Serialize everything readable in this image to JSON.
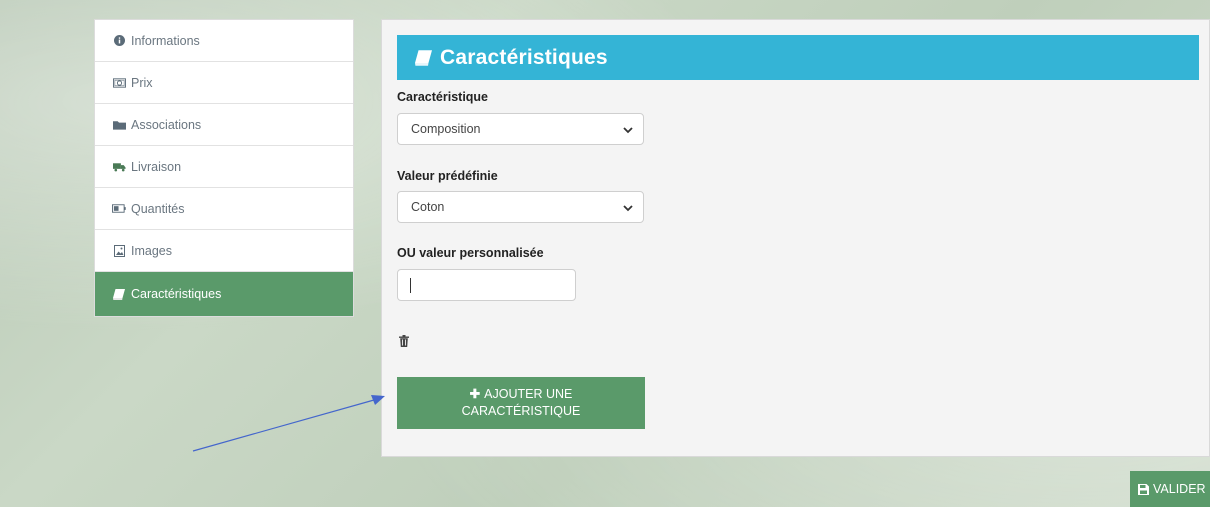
{
  "sidebar": {
    "tabs": [
      {
        "label": "Informations",
        "icon": "info-circle-icon"
      },
      {
        "label": "Prix",
        "icon": "money-icon"
      },
      {
        "label": "Associations",
        "icon": "folder-icon"
      },
      {
        "label": "Livraison",
        "icon": "truck-icon"
      },
      {
        "label": "Quantités",
        "icon": "battery-icon"
      },
      {
        "label": "Images",
        "icon": "image-icon"
      },
      {
        "label": "Caractéristiques",
        "icon": "book-icon",
        "active": true
      }
    ]
  },
  "panel": {
    "title": "Caractéristiques",
    "feature_label": "Caractéristique",
    "feature_value": "Composition",
    "predefined_label": "Valeur prédéfinie",
    "predefined_value": "Coton",
    "custom_label": "OU valeur personnalisée",
    "custom_value": "",
    "add_button_line1": "AJOUTER UNE",
    "add_button_line2": "CARACTÉRISTIQUE"
  },
  "footer": {
    "validate_label": "VALIDER"
  },
  "colors": {
    "accent_green": "#5a9a6a",
    "header_blue": "#34b4d6",
    "annotation_arrow": "#4466cc"
  }
}
